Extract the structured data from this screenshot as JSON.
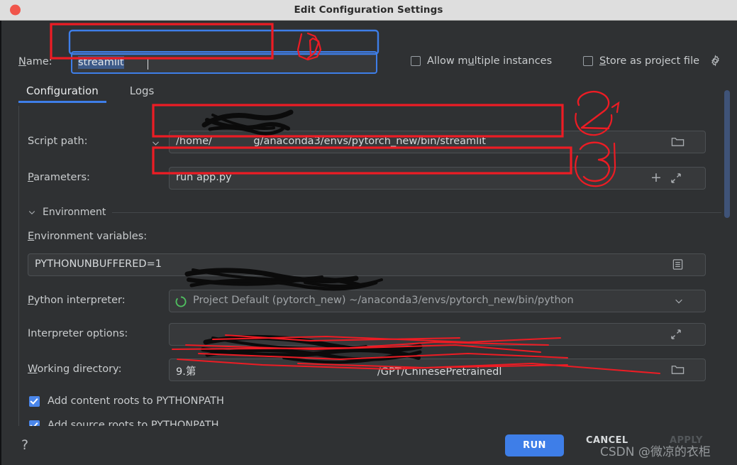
{
  "window": {
    "title": "Edit Configuration Settings",
    "close_icon": "close-dot-icon"
  },
  "name_row": {
    "label": "Name:",
    "value": "streamlit",
    "allow_multiple_label": "Allow multiple instances",
    "allow_multiple_checked": false,
    "store_as_project_file_label": "Store as project file",
    "store_as_project_file_checked": false,
    "gear_icon": "gear-icon"
  },
  "tabs": [
    {
      "label": "Configuration",
      "active": true
    },
    {
      "label": "Logs",
      "active": false
    }
  ],
  "fields": {
    "script_path": {
      "label": "Script path:",
      "value": "/home/███████g/anaconda3/envs/pytorch_new/bin/streamlit",
      "visible_text_prefix": "/home/",
      "visible_text_suffix": "g/anaconda3/envs/pytorch_new/bin/streamlit",
      "dropdown_icon": "chevron-down-icon",
      "browse_icon": "folder-icon"
    },
    "parameters": {
      "label": "Parameters:",
      "value": "run app.py",
      "add_icon": "plus-icon",
      "expand_icon": "expand-arrows-icon"
    },
    "environment_section": {
      "title": "Environment",
      "collapse_icon": "chevron-down-icon"
    },
    "environment_variables": {
      "label": "Environment variables:",
      "value": "PYTHONUNBUFFERED=1",
      "edit_icon": "list-edit-icon"
    },
    "python_interpreter": {
      "label": "Python interpreter:",
      "value": "Project Default (pytorch_new) ~/anaconda3/envs/pytorch_new/bin/python",
      "visible_text": "/anaconda3/envs/pytorch_new/bin/python",
      "status_icon": "loading-spinner-icon",
      "dropdown_icon": "chevron-down-icon"
    },
    "interpreter_options": {
      "label": "Interpreter options:",
      "value": "",
      "expand_icon": "expand-arrows-icon"
    },
    "working_directory": {
      "label": "Working directory:",
      "value": "9.第█████████/GPT/ChinesePretrainedl",
      "visible_text_prefix": "9.第",
      "visible_text_suffix": "/GPT/ChinesePretrainedl",
      "browse_icon": "folder-icon"
    }
  },
  "checkboxes": [
    {
      "label": "Add content roots to PYTHONPATH",
      "checked": true
    },
    {
      "label": "Add source roots to PYTHONPATH",
      "checked": true
    }
  ],
  "footer": {
    "help_label": "?",
    "run_label": "RUN",
    "cancel_label": "CANCEL",
    "apply_label": "APPLY"
  },
  "annotations": {
    "marker_1": "1",
    "marker_2": "2",
    "marker_3": "3",
    "accent_red": "#ed1c24",
    "accent_blue": "#3e7ee8"
  },
  "watermark": {
    "text": "CSDN @微凉的衣柜"
  }
}
